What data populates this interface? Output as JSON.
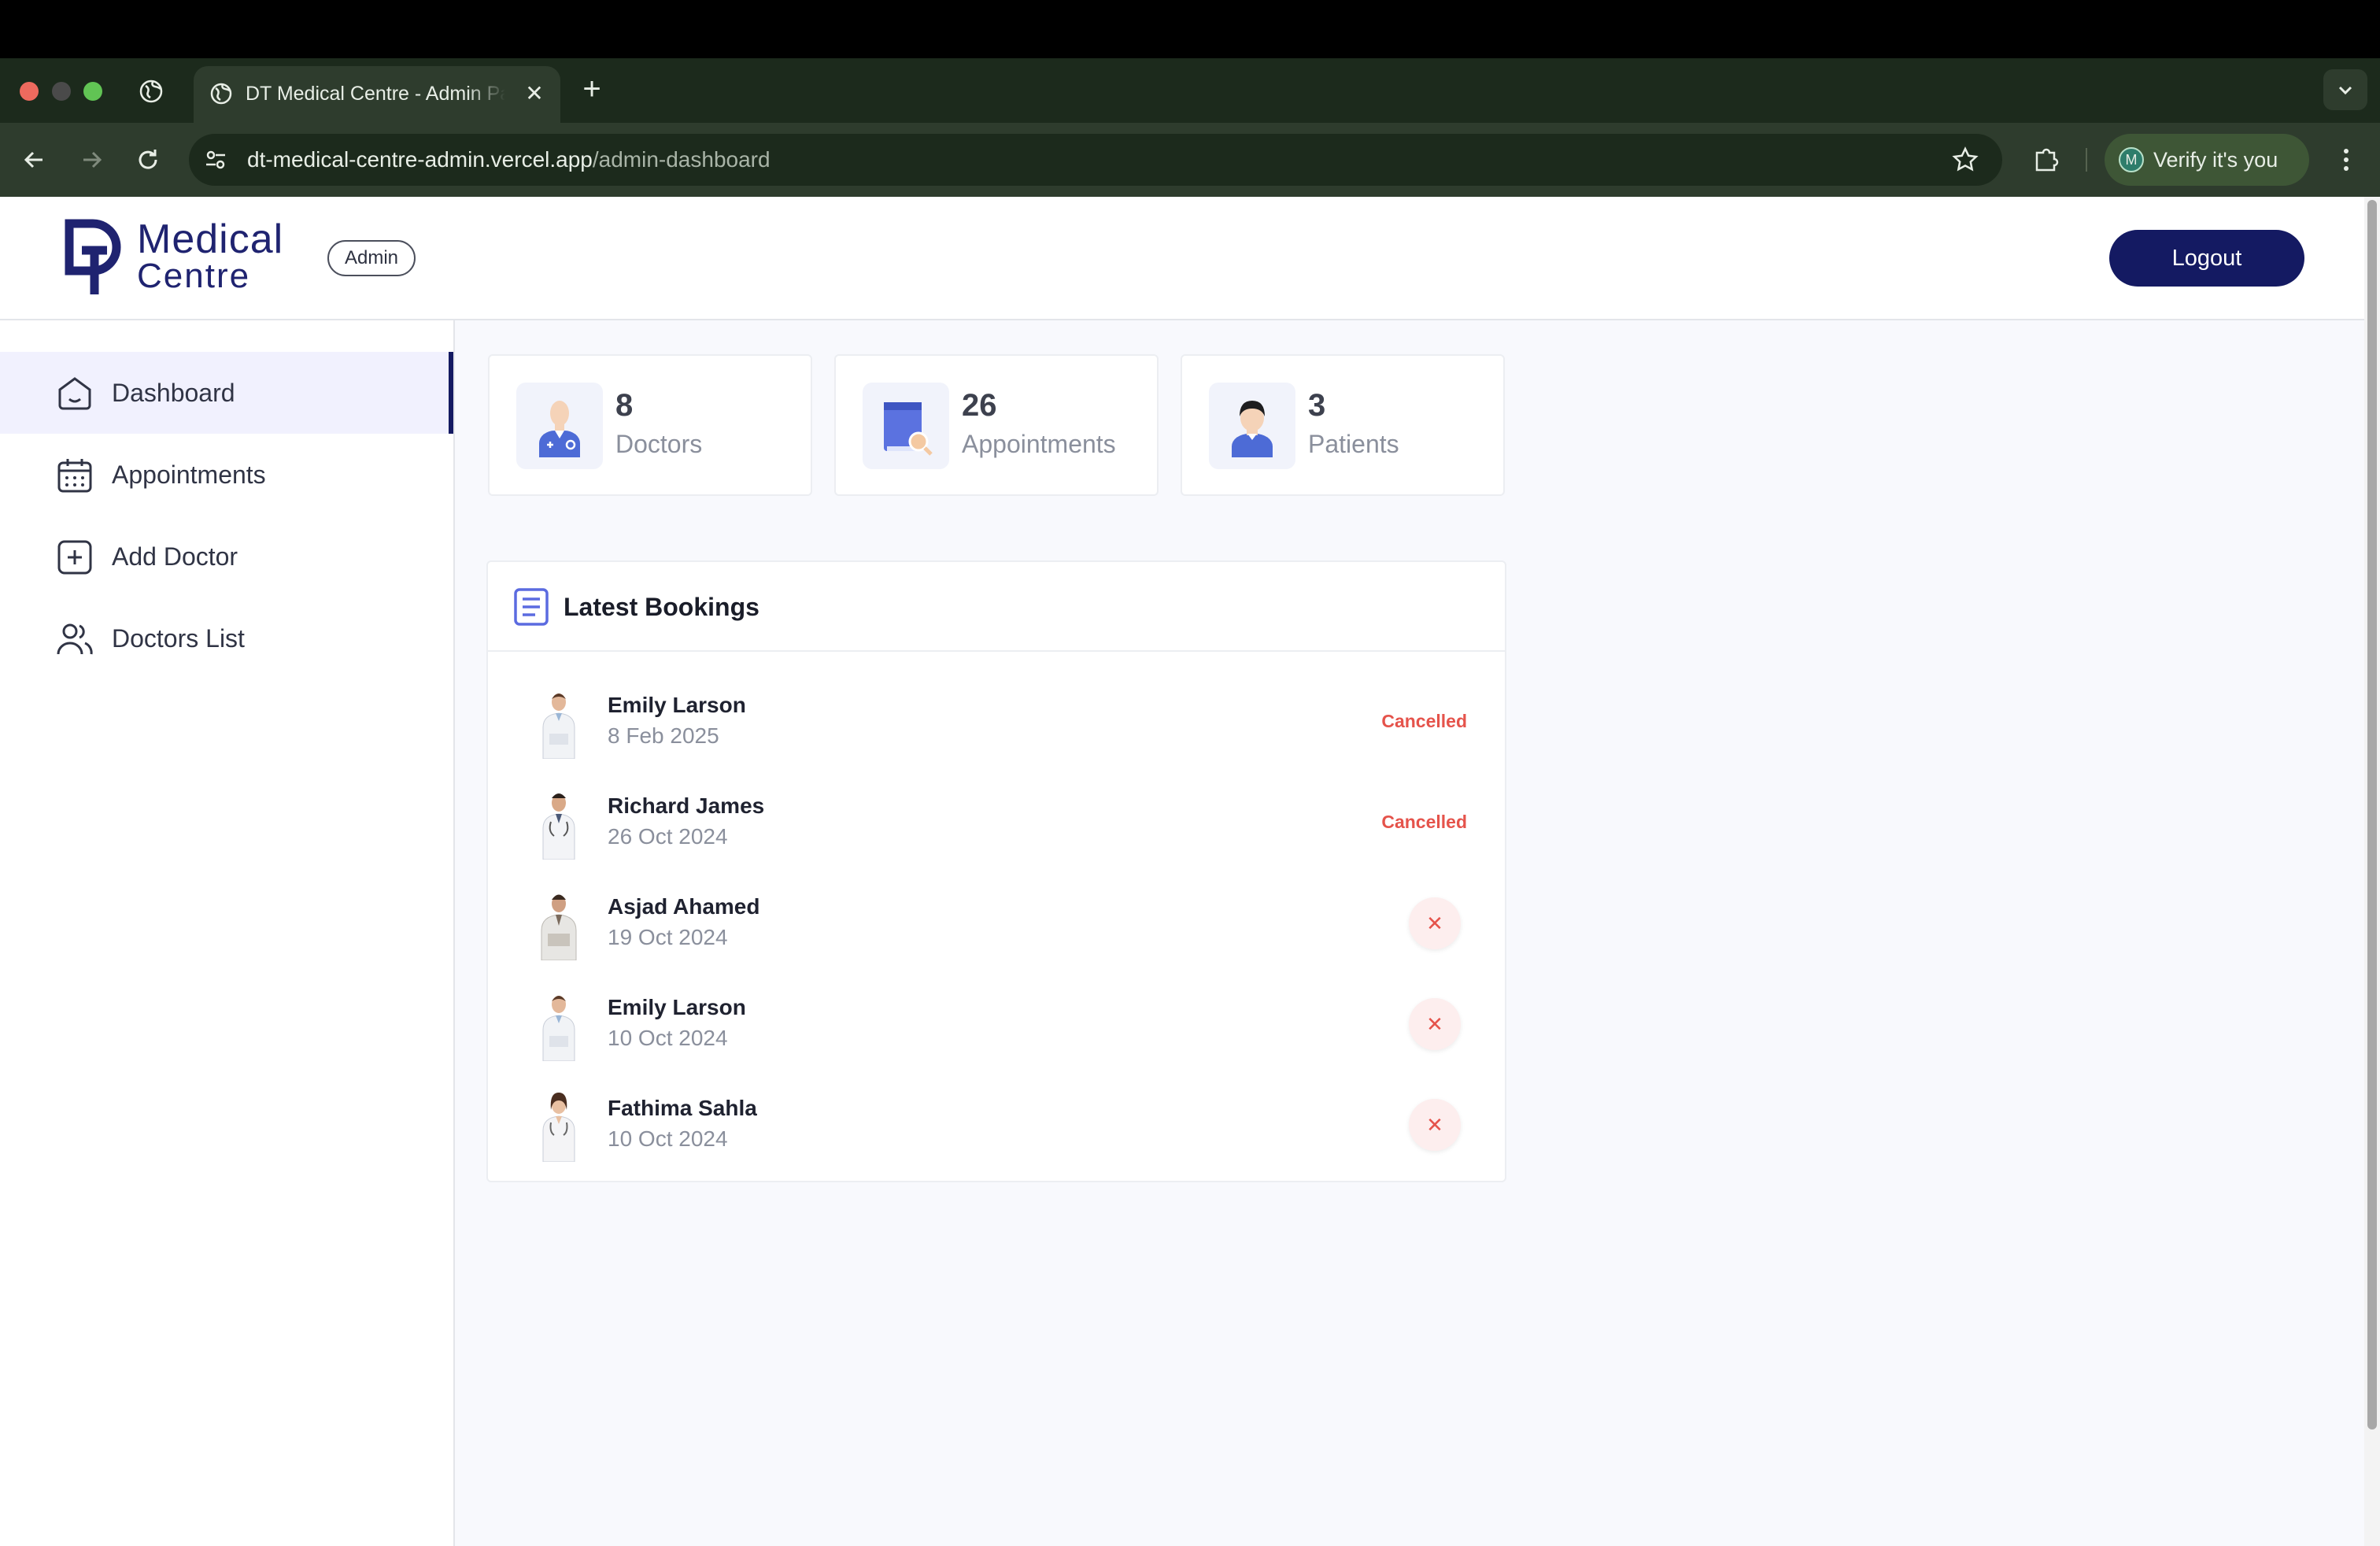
{
  "browser": {
    "tab_title": "DT Medical Centre - Admin Panel",
    "tab_close": "✕",
    "new_tab": "+",
    "url_host": "dt-medical-centre-admin.vercel.app",
    "url_path": "/admin-dashboard",
    "profile_initial": "M",
    "profile_label": "Verify it's you"
  },
  "header": {
    "logo_line1": "Medical",
    "logo_line2": "Centre",
    "role_badge": "Admin",
    "logout_label": "Logout"
  },
  "sidebar": {
    "items": [
      {
        "label": "Dashboard",
        "icon": "home-icon",
        "active": true
      },
      {
        "label": "Appointments",
        "icon": "calendar-icon",
        "active": false
      },
      {
        "label": "Add Doctor",
        "icon": "add-square-icon",
        "active": false
      },
      {
        "label": "Doctors List",
        "icon": "people-icon",
        "active": false
      }
    ]
  },
  "stats": [
    {
      "value": "8",
      "label": "Doctors",
      "icon": "doctor-icon"
    },
    {
      "value": "26",
      "label": "Appointments",
      "icon": "appointment-book-icon"
    },
    {
      "value": "3",
      "label": "Patients",
      "icon": "patient-icon"
    }
  ],
  "bookings": {
    "title": "Latest Bookings",
    "cancel_symbol": "✕",
    "rows": [
      {
        "name": "Emily Larson",
        "date": "8 Feb 2025",
        "status": "Cancelled",
        "cancelled": true
      },
      {
        "name": "Richard James",
        "date": "26 Oct 2024",
        "status": "Cancelled",
        "cancelled": true
      },
      {
        "name": "Asjad Ahamed",
        "date": "19 Oct 2024",
        "status": "",
        "cancelled": false
      },
      {
        "name": "Emily Larson",
        "date": "10 Oct 2024",
        "status": "",
        "cancelled": false
      },
      {
        "name": "Fathima Sahla",
        "date": "10 Oct 2024",
        "status": "",
        "cancelled": false
      }
    ]
  },
  "colors": {
    "primary": "#141a62",
    "active_bg": "#f1f1fe",
    "cancelled": "#e5534b",
    "page_bg": "#f8f9fd"
  }
}
